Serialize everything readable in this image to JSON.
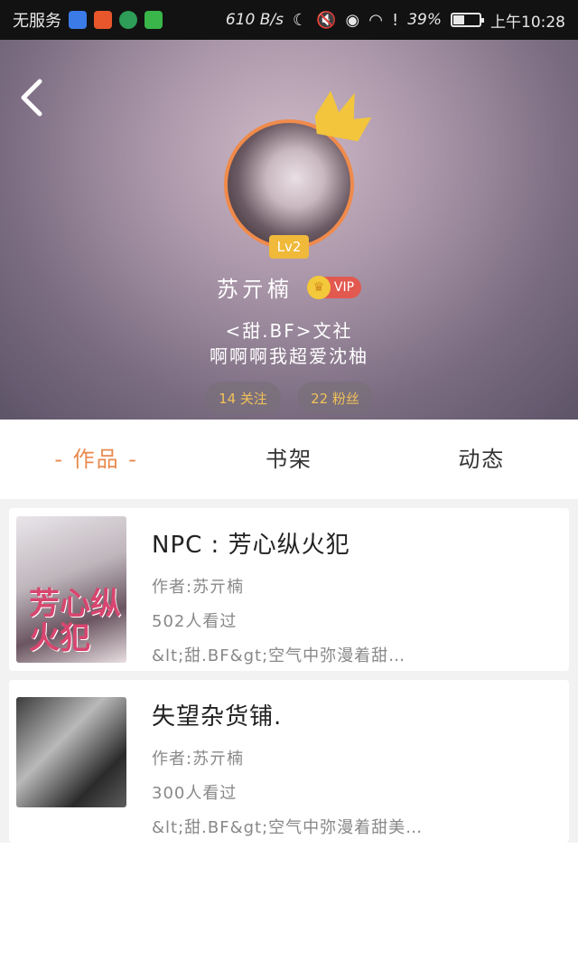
{
  "status_bar": {
    "carrier": "无服务",
    "net_speed": "610 B/s",
    "battery_pct": "39%",
    "time": "上午10:28",
    "icons": [
      "baidu-icon",
      "video-icon",
      "download-icon",
      "iqiyi-icon",
      "moon-icon",
      "mute-icon",
      "eye-icon",
      "wifi-icon",
      "alert-icon",
      "battery-icon"
    ]
  },
  "profile": {
    "level": "Lv2",
    "name": "苏亓楠",
    "vip_label": "VIP",
    "bio_line1": "<甜.BF>文社",
    "bio_line2": "啊啊啊我超爱沈柚",
    "following": "14 关注",
    "fans": "22 粉丝",
    "accent_color": "#f08a4b"
  },
  "tabs": [
    {
      "label": "- 作品 -",
      "active": true
    },
    {
      "label": "书架",
      "active": false
    },
    {
      "label": "动态",
      "active": false
    }
  ],
  "works": [
    {
      "title": "NPC : 芳心纵火犯",
      "author": "作者:苏亓楠",
      "views": "502人看过",
      "desc": "&lt;甜.BF&gt;空气中弥漫着甜…",
      "cover_text": "芳心纵火犯"
    },
    {
      "title": "失望杂货铺.",
      "author": "作者:苏亓楠",
      "views": "300人看过",
      "desc": "&lt;甜.BF&gt;空气中弥漫着甜美…"
    }
  ]
}
